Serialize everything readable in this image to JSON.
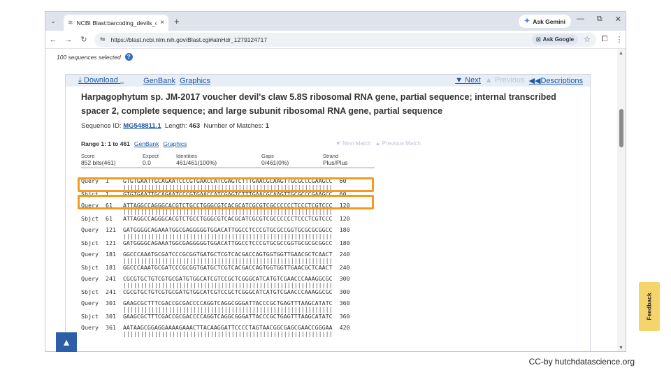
{
  "browser": {
    "tab_title": "NCBI Blast:barcoding_devils_cla",
    "tab_close": "×",
    "new_tab": "+",
    "ask_gemini": "Ask Gemini",
    "url": "https://blast.ncbi.nlm.nih.gov/Blast.cgi#alnHdr_1279124717",
    "ask_google": "Ask Google"
  },
  "page": {
    "selected_text": "100 sequences selected",
    "help": "?",
    "download": "Download",
    "genbank": "GenBank",
    "graphics": "Graphics",
    "next": "Next",
    "previous": "Previous",
    "descriptions": "Descriptions",
    "title": "Harpagophytum sp. JM-2017 voucher devil's claw 5.8S ribosomal RNA gene, partial sequence; internal transcribed spacer 2, complete sequence; and large subunit ribosomal RNA gene, partial sequence",
    "seqid_label": "Sequence ID:",
    "seqid": "MG548811.1",
    "length_label": "Length:",
    "length": "463",
    "matches_label": "Number of Matches:",
    "matches": "1",
    "range": "Range 1: 1 to 461",
    "range_genbank": "GenBank",
    "range_graphics": "Graphics",
    "next_match": "Next Match",
    "previous_match": "Previous Match",
    "stats_headers": [
      "Score",
      "Expect",
      "Identities",
      "Gaps",
      "Strand"
    ],
    "stats_values": [
      "852 bits(461)",
      "0.0",
      "461/461(100%)",
      "0/461(0%)",
      "Plus/Plus"
    ],
    "alignment": [
      {
        "q": "Query  1    GTGTGAATTGCAGAATCCCGTGAACCATCGAGTCTTTGAACGCAAGTTGCGCCCGAAGCC  60",
        "b": "            ||||||||||||||||||||||||||||||||||||||||||||||||||||||||||||",
        "s": "Sbjct  1    GTGTGAATTGCAGAATCCCGTGAACCATCGAGTCTTTGAACGCAAGTTGCGCCCGAAGCC  60"
      },
      {
        "q": "Query  61   ATTAGGCCAGGGCACGTCTGCCTGGGCGTCACGCATCGCGTCGCCCCCCTCCCTCGTCCC  120",
        "b": "            ||||||||||||||||||||||||||||||||||||||||||||||||||||||||||||",
        "s": "Sbjct  61   ATTAGGCCAGGGCACGTCTGCCTGGGCGTCACGCATCGCGTCGCCCCCCTCCCTCGTCCC  120"
      },
      {
        "q": "Query  121  GATGGGGCAGAAATGGCGAGGGGGTGGACATTGGCCTCCCGTGCGCCGGTGCGCGCGGCC  180",
        "b": "            ||||||||||||||||||||||||||||||||||||||||||||||||||||||||||||",
        "s": "Sbjct  121  GATGGGGCAGAAATGGCGAGGGGGTGGACATTGGCCTCCCGTGCGCCGGTGCGCGCGGCC  180"
      },
      {
        "q": "Query  181  GGCCCAAATGCGATCCCGCGGTGATGCTCGTCACGACCAGTGGTGGTTGAACGCTCAACT  240",
        "b": "            ||||||||||||||||||||||||||||||||||||||||||||||||||||||||||||",
        "s": "Sbjct  181  GGCCCAAATGCGATCCCGCGGTGATGCTCGTCACGACCAGTGGTGGTTGAACGCTCAACT  240"
      },
      {
        "q": "Query  241  CGCGTGCTGTCGTGCGATGTGGCATCGTCCGCTCGGGCATCATGTCGAACCCAAAGGCGC  300",
        "b": "            ||||||||||||||||||||||||||||||||||||||||||||||||||||||||||||",
        "s": "Sbjct  241  CGCGTGCTGTCGTGCGATGTGGCATCGTCCGCTCGGGCATCATGTCGAACCCAAAGGCGC  300"
      },
      {
        "q": "Query  301  GAAGCGCTTTCGACCGCGACCCCAGGTCAGGCGGGATTACCCGCTGAGTTTAAGCATATC  360",
        "b": "            ||||||||||||||||||||||||||||||||||||||||||||||||||||||||||||",
        "s": "Sbjct  301  GAAGCGCTTTCGACCGCGACCCCAGGTCAGGCGGGATTACCCGCTGAGTTTAAGCATATC  360"
      },
      {
        "q": "Query  361  AATAAGCGGAGGAAAAGAAACTTACAAGGATTCCCCTAGTAACGGCGAGCGAACCGGGAA  420",
        "b": "            ||||||||||||||||||||||||||||||||||||||||||||||||||||||||||||",
        "s": ""
      }
    ],
    "feedback": "Feedback"
  },
  "credit": "CC-by hutchdatascience.org"
}
